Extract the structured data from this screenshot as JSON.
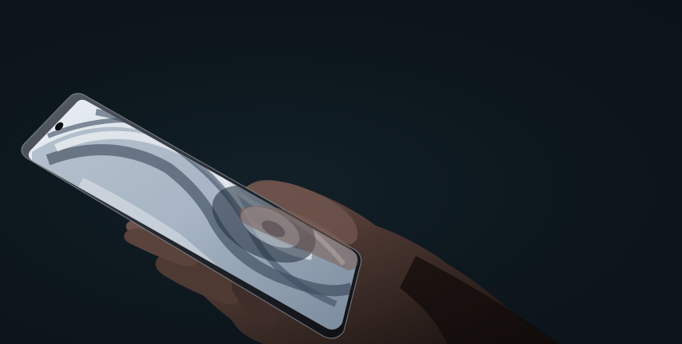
{
  "scene": {
    "background_color": "#0c161c",
    "subject": "phone-in-hand",
    "screen_wallpaper_colors": [
      "#e8eef4",
      "#9fb0c2",
      "#4a5c70",
      "#1e2a38"
    ],
    "phone_frame_color": "#1a1d22",
    "skin_colors": [
      "#6a5048",
      "#3a2a26",
      "#1c1412"
    ]
  }
}
